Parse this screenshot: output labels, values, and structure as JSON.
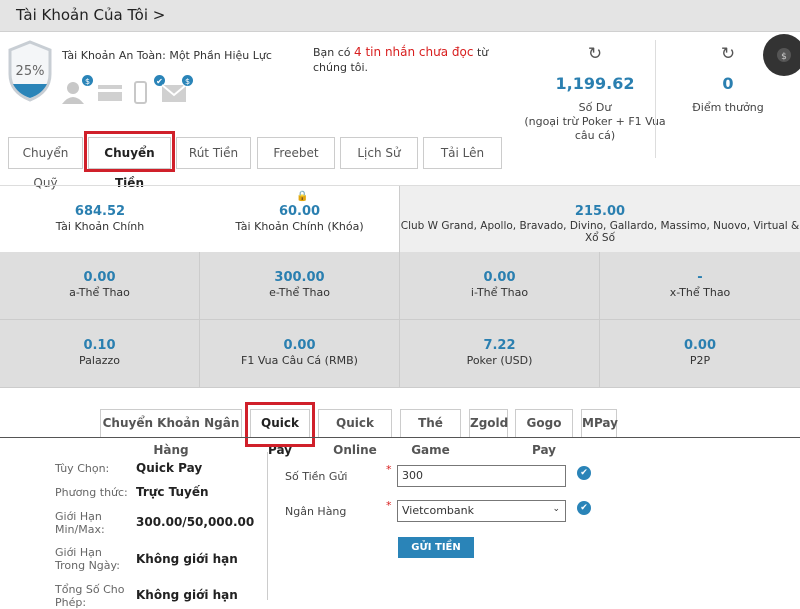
{
  "header": {
    "title": "Tài Khoản Của Tôi >"
  },
  "security": {
    "percent": "25%",
    "title": "Tài Khoản An Toàn: Một Phần Hiệu Lực",
    "icons": [
      "user-icon",
      "card-icon",
      "phone-icon",
      "mail-icon"
    ],
    "badges": [
      "$",
      "",
      "✔",
      "$"
    ]
  },
  "message": {
    "prefix": "Bạn có ",
    "highlight": "4 tin nhắn chưa đọc",
    "suffix": " từ chúng tôi."
  },
  "balance": {
    "value": "1,199.62",
    "label": "Số Dư",
    "note": "(ngoại trừ Poker + F1 Vua câu cá)"
  },
  "points": {
    "value": "0",
    "label": "Điểm thưởng"
  },
  "tabs": [
    "Chuyển Quỹ",
    "Chuyển Tiền",
    "Rút Tiền",
    "Freebet",
    "Lịch Sử",
    "Tải Lên"
  ],
  "accounts_top": [
    {
      "value": "684.52",
      "label": "Tài Khoản Chính"
    },
    {
      "value": "60.00",
      "label": "Tài Khoản Chính (Khóa)"
    },
    {
      "value": "215.00",
      "label": "Club W Grand, Apollo, Bravado, Divino, Gallardo, Massimo, Nuovo, Virtual & Xổ Số"
    }
  ],
  "accounts_grid": [
    {
      "value": "0.00",
      "label": "a-Thể Thao"
    },
    {
      "value": "300.00",
      "label": "e-Thể Thao"
    },
    {
      "value": "0.00",
      "label": "i-Thể Thao"
    },
    {
      "value": "-",
      "label": "x-Thể Thao"
    },
    {
      "value": "0.10",
      "label": "Palazzo"
    },
    {
      "value": "0.00",
      "label": "F1 Vua Câu Cá (RMB)"
    },
    {
      "value": "7.22",
      "label": "Poker (USD)"
    },
    {
      "value": "0.00",
      "label": "P2P"
    }
  ],
  "methods": [
    "Chuyển Khoản Ngân Hàng",
    "Quick Pay",
    "Quick Online",
    "Thé Game",
    "Zgold",
    "Gogo Pay",
    "MPay"
  ],
  "info": [
    {
      "label": "Tùy Chọn:",
      "value": "Quick Pay"
    },
    {
      "label": "Phương thức:",
      "value": "Trực Tuyến"
    },
    {
      "label": "Giới Hạn Min/Max:",
      "value": "300.00/50,000.00"
    },
    {
      "label": "Giới Hạn Trong Ngày:",
      "value": "Không giới hạn"
    },
    {
      "label": "Tổng Số Cho Phép:",
      "value": "Không giới hạn"
    }
  ],
  "form": {
    "amount_label": "Số Tiền Gửi",
    "amount_value": "300",
    "bank_label": "Ngân Hàng",
    "bank_value": "Vietcombank",
    "required": "*",
    "submit": "GỬI TIỀN"
  },
  "colors": {
    "accent": "#2a7fb0",
    "highlight": "#d0202a"
  }
}
